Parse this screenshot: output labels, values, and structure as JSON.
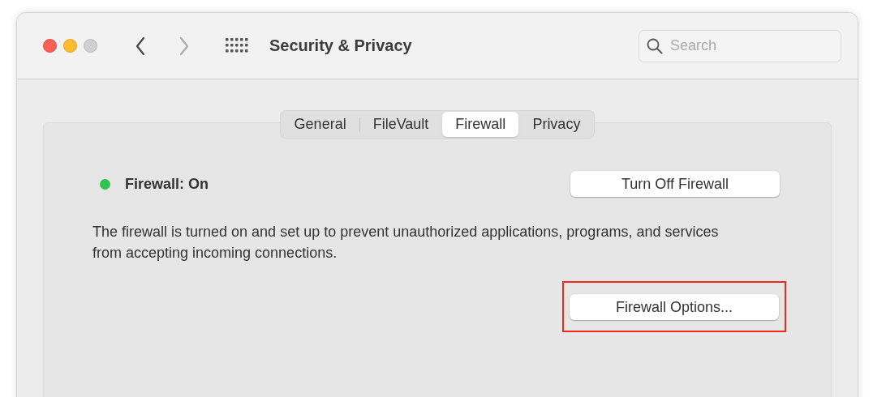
{
  "window": {
    "title": "Security & Privacy"
  },
  "search": {
    "placeholder": "Search"
  },
  "tabs": [
    {
      "label": "General",
      "selected": false
    },
    {
      "label": "FileVault",
      "selected": false
    },
    {
      "label": "Firewall",
      "selected": true
    },
    {
      "label": "Privacy",
      "selected": false
    }
  ],
  "firewall": {
    "status": "Firewall: On",
    "on": true,
    "toggle_button": "Turn Off Firewall",
    "description": "The firewall is turned on and set up to prevent unauthorized applications, programs, and services from accepting incoming connections.",
    "options_button": {
      "label": "Firewall Options...",
      "highlighted": true
    }
  }
}
